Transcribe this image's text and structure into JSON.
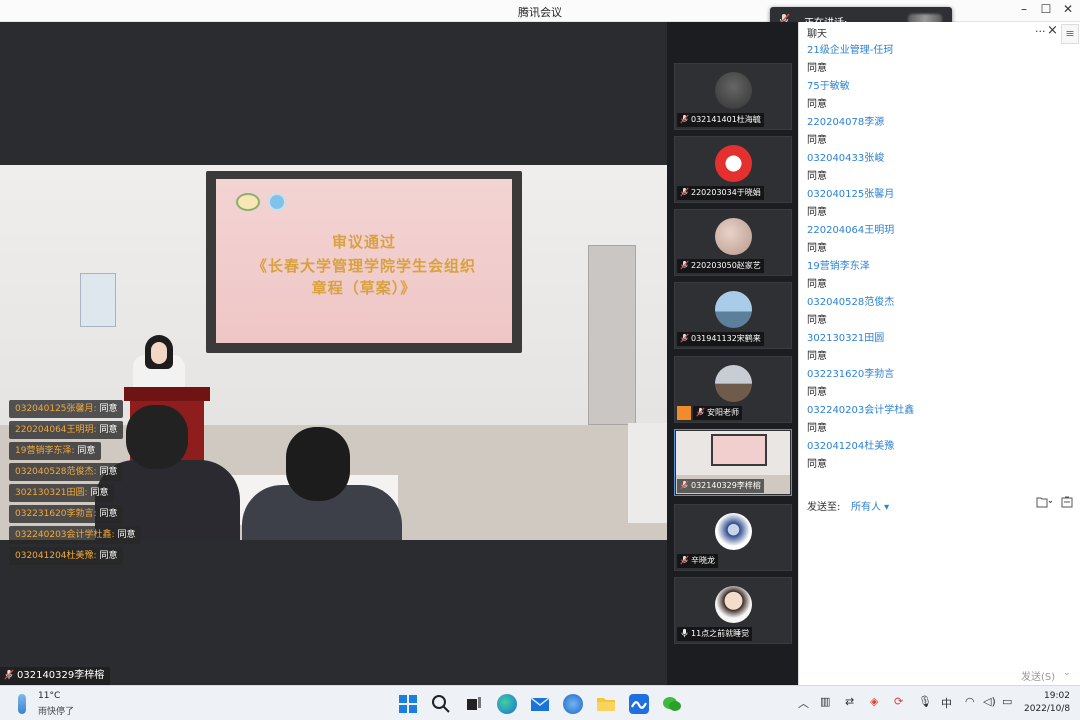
{
  "window": {
    "title": "腾讯会议"
  },
  "speaking_toast": {
    "label": "正在讲话:"
  },
  "slide": {
    "line1": "审议通过",
    "line2": "《长春大学管理学院学生会组织",
    "line3": "章程（草案）》"
  },
  "overlay_comments": [
    {
      "who": "032040125张馨月:",
      "msg": "同意"
    },
    {
      "who": "220204064王明玥:",
      "msg": "同意"
    },
    {
      "who": "19营销李东泽:",
      "msg": "同意"
    },
    {
      "who": "032040528范俊杰:",
      "msg": "同意"
    },
    {
      "who": "302130321田圆:",
      "msg": "同意"
    },
    {
      "who": "032231620李勃言:",
      "msg": "同意"
    },
    {
      "who": "032240203会计学杜鑫:",
      "msg": "同意"
    },
    {
      "who": "032041204杜美豫:",
      "msg": "同意"
    }
  ],
  "main_speaker": {
    "name": "032140329李梓榕"
  },
  "participants": [
    {
      "name": "032141401杜海毓",
      "icon": "muted-mic-icon"
    },
    {
      "name": "220203034于晓娟",
      "icon": "muted-mic-icon"
    },
    {
      "name": "220203050赵家艺",
      "icon": "muted-mic-icon"
    },
    {
      "name": "031941132宋鹤来",
      "icon": "muted-mic-icon"
    },
    {
      "name": "安阳老师",
      "icon": "muted-mic-icon",
      "host": true
    },
    {
      "name": "032140329李梓榕",
      "icon": "muted-mic-icon"
    },
    {
      "name": "辛晓龙",
      "icon": "muted-mic-icon"
    },
    {
      "name": "11点之前就睡觉",
      "icon": "mic-icon"
    }
  ],
  "chat": {
    "title": "聊天",
    "more": "···",
    "close": "×",
    "side_menu": "≡",
    "messages": [
      {
        "sender": "21级企业管理-任珂",
        "text": "同意"
      },
      {
        "sender": "75于敏敏",
        "text": "同意"
      },
      {
        "sender": "220204078李源",
        "text": "同意"
      },
      {
        "sender": "032040433张峻",
        "text": "同意"
      },
      {
        "sender": "032040125张馨月",
        "text": "同意"
      },
      {
        "sender": "220204064王明玥",
        "text": "同意"
      },
      {
        "sender": "19营销李东泽",
        "text": "同意"
      },
      {
        "sender": "032040528范俊杰",
        "text": "同意"
      },
      {
        "sender": "302130321田圆",
        "text": "同意"
      },
      {
        "sender": "032231620李勃言",
        "text": "同意"
      },
      {
        "sender": "032240203会计学杜鑫",
        "text": "同意"
      },
      {
        "sender": "032041204杜美豫",
        "text": "同意"
      }
    ],
    "send_to_label": "发送至:",
    "send_to_value": "所有人 ▾",
    "send_button": "发送(S)",
    "send_arrow": "⌄"
  },
  "taskbar": {
    "temperature": "11°C",
    "weather": "雨快停了",
    "ime": "中",
    "time": "19:02",
    "date": "2022/10/8"
  },
  "colors": {
    "accent": "#2d82d3",
    "comment_name": "#f2a93b",
    "host_badge": "#f08c2a"
  }
}
